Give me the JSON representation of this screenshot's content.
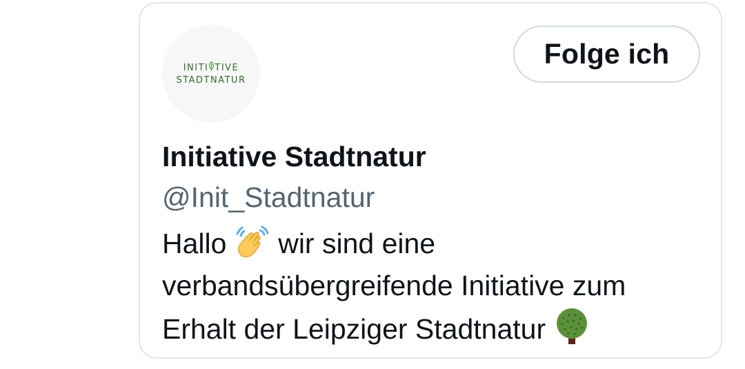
{
  "profile": {
    "avatar_logo": {
      "line1": "INITI",
      "line1b": "TIVE",
      "line2": "STADTNATUR"
    },
    "name": "Initiative Stadtnatur",
    "handle": "@Init_Stadtnatur",
    "follow_label": "Folge ich",
    "bio": {
      "line1_a": "Hallo ",
      "line1_b": " wir sind eine",
      "line2": "verbandsübergreifende Initiative zum",
      "line3": "Erhalt der Leipziger Stadtnatur "
    },
    "icons": {
      "wave": "waving-hand-icon",
      "tree": "tree-icon",
      "leaf": "leaf-icon"
    }
  },
  "colors": {
    "text": "#0f1419",
    "muted": "#536471",
    "border": "#e4e6e8",
    "logo_green": "#2f6b2a"
  }
}
